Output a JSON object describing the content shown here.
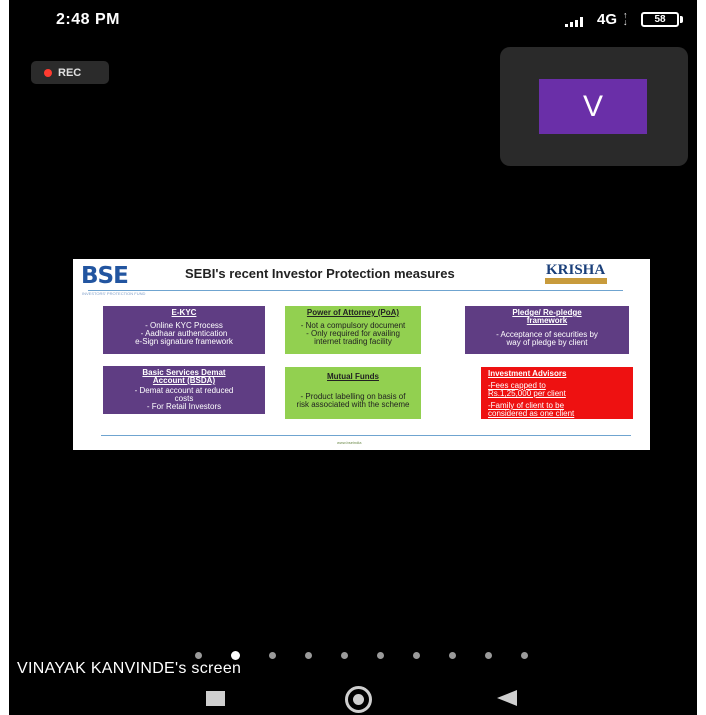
{
  "status_bar": {
    "time": "2:48 PM",
    "network": "4G",
    "battery": "58"
  },
  "recording": {
    "label": "REC"
  },
  "participant_tile": {
    "initial": "V"
  },
  "slide": {
    "logo": "BSE",
    "logo_subtitle": "INVESTORS' PROTECTION FUND",
    "title": "SEBI's recent Investor Protection measures",
    "brand": "KRISHA",
    "footer": "www.bseindia",
    "boxes": {
      "ekyc": {
        "heading": "E-KYC",
        "lines": [
          "- Online KYC Process",
          "- Aadhaar authentication",
          "e-Sign signature framework"
        ]
      },
      "poa": {
        "heading": "Power of Attorney (PoA)",
        "lines": [
          "- Not a compulsory document",
          "- Only required for availing",
          "internet trading facility"
        ]
      },
      "pledge": {
        "heading": "Pledge/ Re-pledge",
        "heading2": "framework",
        "lines": [
          "- Acceptance of securities by",
          "way of pledge by client"
        ]
      },
      "bsda": {
        "heading": "Basic Services Demat",
        "heading2": "Account (BSDA)",
        "lines": [
          "- Demat account at reduced",
          "costs",
          "- For Retail Investors"
        ]
      },
      "mf": {
        "heading": "Mutual Funds",
        "lines": [
          "- Product labelling on basis of",
          "risk associated with the scheme"
        ]
      },
      "ia": {
        "heading": "Investment Advisors",
        "lines": [
          "-Fees capped to",
          "Rs.1,25,000 per client",
          "-Family of client to be",
          "considered as one client"
        ]
      }
    }
  },
  "pager": {
    "count": 10,
    "active_index": 1
  },
  "screen_owner": "VINAYAK KANVINDE's screen",
  "colors": {
    "purple_box": "#5f3d83",
    "green_box": "#92d050",
    "red_box": "#ee1111",
    "avatar": "#6a2fa8"
  }
}
